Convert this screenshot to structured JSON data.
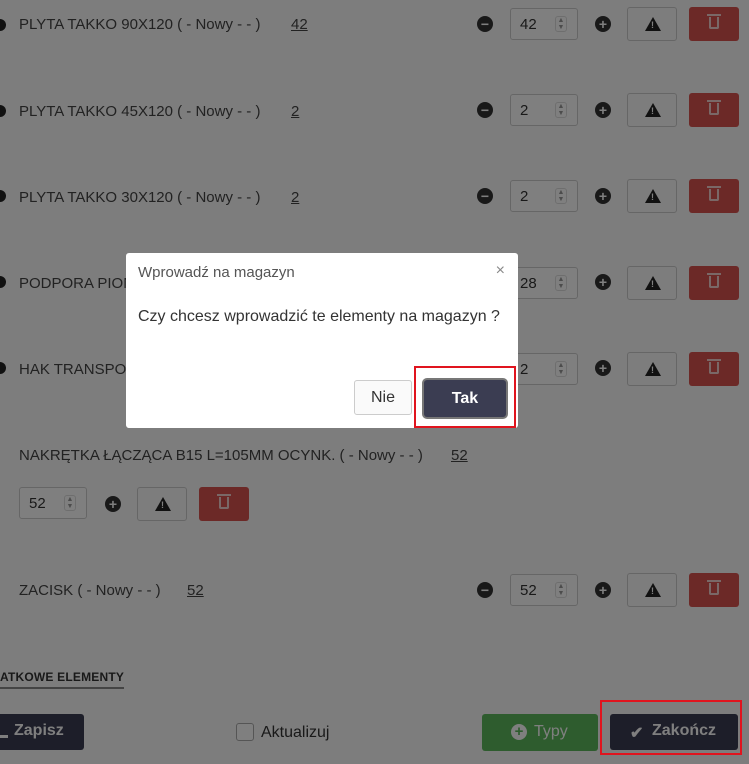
{
  "items": [
    {
      "label": "PLYTA TAKKO 90X120 ( - Nowy - - )",
      "qty_link": "42",
      "qty": "42"
    },
    {
      "label": "PLYTA TAKKO 45X120 ( - Nowy - - )",
      "qty_link": "2",
      "qty": "2"
    },
    {
      "label": "PLYTA TAKKO 30X120 ( - Nowy - - )",
      "qty_link": "2",
      "qty": "2"
    },
    {
      "label": "PODPORA PION",
      "qty_link": "",
      "qty": "28"
    },
    {
      "label": "HAK TRANSPO",
      "qty_link": "",
      "qty": "2"
    },
    {
      "label": "NAKRĘTKA ŁĄCZĄCA B15 L=105MM OCYNK. ( - Nowy - - )",
      "qty_link": "52",
      "qty": "52"
    },
    {
      "label": "ZACISK ( - Nowy - - )",
      "qty_link": "52",
      "qty": "52"
    }
  ],
  "icons": {
    "minus": "minus-circle-icon",
    "plus": "plus-circle-icon",
    "warning": "warning-icon",
    "delete": "trash-icon",
    "save": "download-icon",
    "types": "plus-circle-icon",
    "finish": "check-icon"
  },
  "section_title": "ATKOWE ELEMENTY",
  "footer": {
    "save_label": "Zapisz",
    "update_label": "Aktualizuj",
    "types_label": "Typy",
    "finish_label": "Zakończ"
  },
  "modal": {
    "title": "Wprowadź na magazyn",
    "close": "×",
    "message": "Czy chcesz wprowadzić te elementy na magazyn ?",
    "no_label": "Nie",
    "yes_label": "Tak"
  },
  "colors": {
    "primary_dark": "#3b3d52",
    "success": "#5cb85c",
    "danger": "#d9534f",
    "highlight": "#e0141e"
  }
}
